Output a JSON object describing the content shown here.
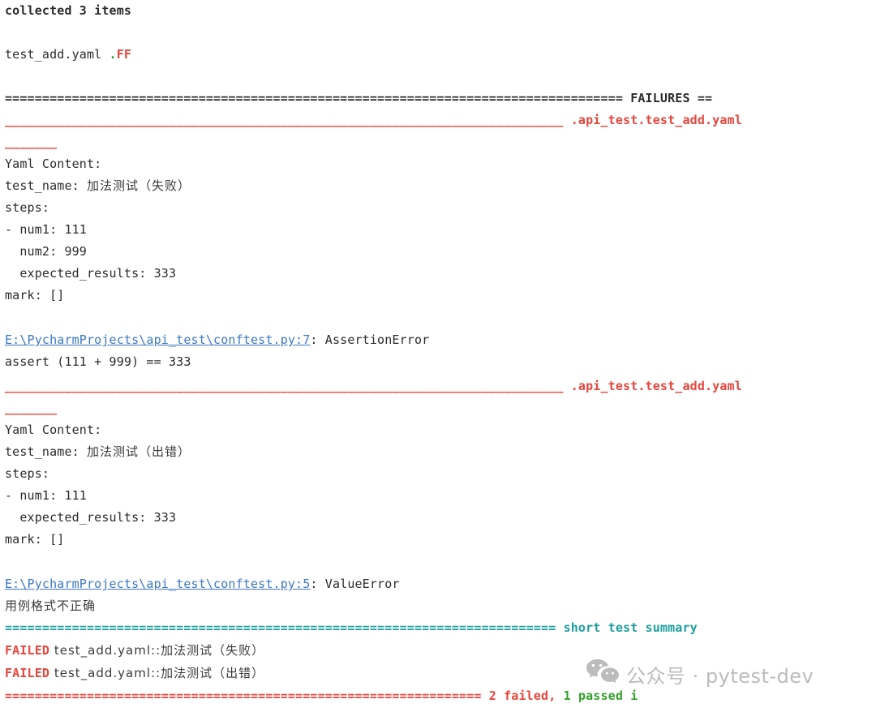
{
  "terminal": {
    "collected": "collected 3 items",
    "progress": {
      "file": "test_add.yaml ",
      "passed_marks": ".",
      "failed_marks": "FF"
    },
    "failures_header": {
      "left_rule": "=================================================================================== ",
      "title": "FAILURES",
      "right_rule": " =="
    },
    "failure_1": {
      "rule": "___________________________________________________________________________ ",
      "test_id": ".api_test.test_add.yaml",
      "rule_wrap": "_______",
      "yaml_label": "Yaml Content:",
      "name_key": "test_name: ",
      "name_value": "加法测试（失败）",
      "steps_key": "steps:",
      "num1": "- num1: 111",
      "num2": "  num2: 999",
      "expected": "  expected_results: 333",
      "mark": "mark: []",
      "error_link": "E:\\PycharmProjects\\api_test\\conftest.py:7",
      "error_type": ": AssertionError",
      "error_detail": "assert (111 + 999) == 333"
    },
    "failure_2": {
      "rule": "___________________________________________________________________________ ",
      "test_id": ".api_test.test_add.yaml",
      "rule_wrap": "_______",
      "yaml_label": "Yaml Content:",
      "name_key": "test_name: ",
      "name_value": "加法测试（出错）",
      "steps_key": "steps:",
      "num1": "- num1: 111",
      "expected": "  expected_results: 333",
      "mark": "mark: []",
      "error_link": "E:\\PycharmProjects\\api_test\\conftest.py:5",
      "error_type": ": ValueError",
      "error_detail": "用例格式不正确"
    },
    "summary_header": {
      "left_rule": "========================================================================== ",
      "title": "short test summary",
      "right_rule": ""
    },
    "summary_lines": [
      {
        "status": "FAILED",
        "test": " test_add.yaml::加法测试（失败）"
      },
      {
        "status": "FAILED",
        "test": " test_add.yaml::加法测试（出错）"
      }
    ],
    "final_line": {
      "left_rule": "================================================================ ",
      "failed": "2 failed",
      "separator": ", ",
      "passed": "1 passed",
      "trailing": " i"
    }
  },
  "watermark": {
    "icon": "wechat-icon",
    "text": "公众号 · pytest-dev"
  },
  "colors": {
    "red": "#e8453c",
    "green": "#33a02c",
    "teal": "#1f9e9e",
    "link": "#3b78c3",
    "text": "#2b2b2b",
    "watermark": "#bcbcbc",
    "background": "#ffffff"
  }
}
